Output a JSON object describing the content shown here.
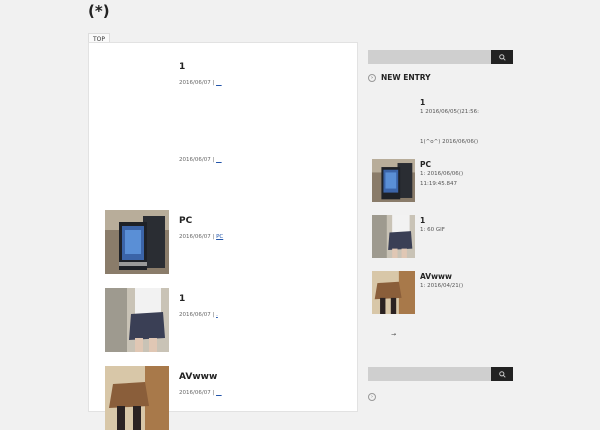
{
  "site": {
    "title": "(*)"
  },
  "nav": {
    "top_label": "TOP"
  },
  "posts": [
    {
      "title": "1",
      "date": "2016/06/07",
      "sep": "|",
      "category": "__"
    },
    {
      "title": "",
      "date": "2016/06/07",
      "sep": "|",
      "category": "__"
    },
    {
      "title": "PC",
      "date": "2016/06/07",
      "sep": "|",
      "category": "PC"
    },
    {
      "title": "1",
      "date": "2016/06/07",
      "sep": "|",
      "category": "."
    },
    {
      "title": "AVwww",
      "date": "2016/06/07",
      "sep": "|",
      "category": "__"
    }
  ],
  "sidebar": {
    "search": {
      "placeholder": "",
      "button_icon": "search-icon"
    },
    "new_entry": {
      "heading": "NEW ENTRY",
      "items": [
        {
          "title": "1",
          "line1": "1 2016/06/05()21:56:",
          "line2": "1(^o^) 2016/06/06()"
        },
        {
          "title": "PC",
          "line1": "1:        2016/06/06()",
          "line2": "11:19:45.847"
        },
        {
          "title": "1",
          "line1": "1:  60                GIF",
          "line2": ""
        },
        {
          "title": "AVwww",
          "line1": "1:                    2016/04/21()",
          "line2": ""
        }
      ],
      "more_arrow": "→"
    }
  },
  "colors": {
    "accent_dark": "#222222",
    "search_bg": "#cfcfcf",
    "link": "#2255aa"
  }
}
